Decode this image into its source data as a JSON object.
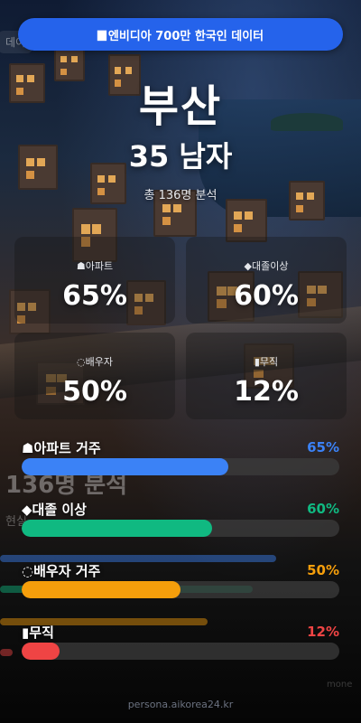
{
  "header": {
    "title": "엔비디아 700만 한국인 데이터",
    "icon": "flag-icon"
  },
  "city": "부산",
  "subject": "35 남자",
  "sample": "총 136명 분석",
  "cards": [
    {
      "icon": "apartment-icon",
      "label": "아파트",
      "value": "65%"
    },
    {
      "icon": "graduation-cap-icon",
      "label": "대졸이상",
      "value": "60%"
    },
    {
      "icon": "ring-icon",
      "label": "배우자",
      "value": "50%"
    },
    {
      "icon": "clipboard-icon",
      "label": "무직",
      "value": "12%"
    }
  ],
  "metrics": [
    {
      "label": "아파트 거주",
      "value": "65%",
      "fraction": 0.65,
      "color": "#3b82f6"
    },
    {
      "label": "대졸 이상",
      "value": "60%",
      "fraction": 0.6,
      "color": "#10b981"
    },
    {
      "label": "배우자 거주",
      "value": "50%",
      "fraction": 0.5,
      "color": "#f59e0b"
    },
    {
      "label": "무직",
      "value": "12%",
      "fraction": 0.12,
      "color": "#ef4444"
    }
  ],
  "footer": "persona.aikorea24.kr"
}
